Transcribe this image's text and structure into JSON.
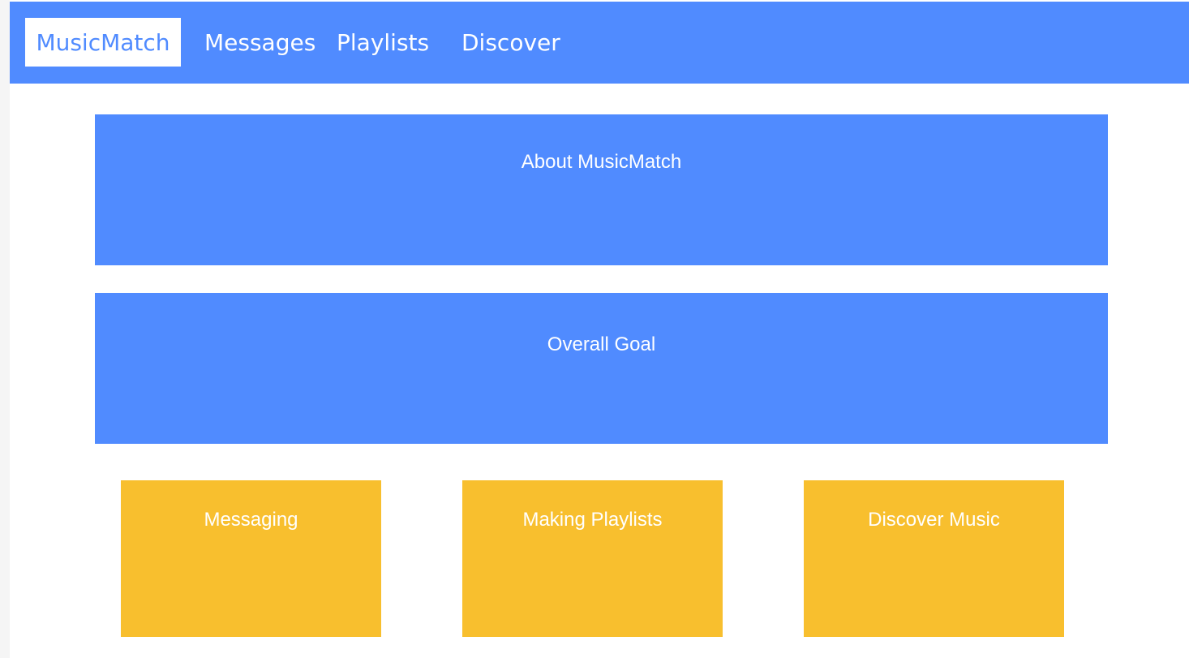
{
  "nav": {
    "brand": "MusicMatch",
    "links": [
      "Messages",
      "Playlists",
      "Discover"
    ]
  },
  "sections": {
    "about": "About MusicMatch",
    "goal": "Overall Goal"
  },
  "cards": [
    "Messaging",
    "Making Playlists",
    "Discover Music"
  ],
  "colors": {
    "primary": "#508bff",
    "accent": "#f8bf2e",
    "text_on_color": "#ffffff"
  }
}
